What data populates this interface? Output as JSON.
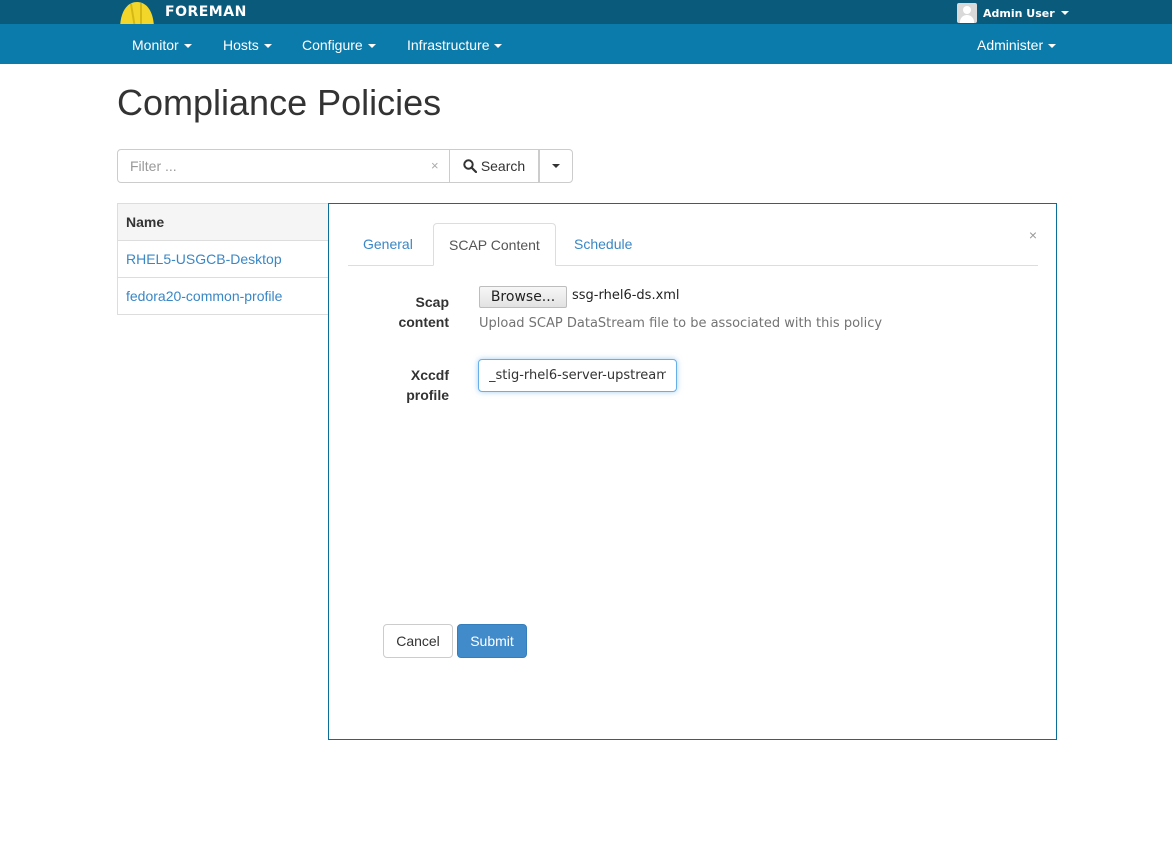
{
  "header": {
    "brand": "FOREMAN",
    "user": "Admin User"
  },
  "nav": {
    "items": [
      "Monitor",
      "Hosts",
      "Configure",
      "Infrastructure"
    ],
    "right": "Administer"
  },
  "page": {
    "title": "Compliance Policies"
  },
  "search": {
    "placeholder": "Filter ...",
    "clear": "×",
    "button_label": "Search"
  },
  "table": {
    "header": "Name",
    "rows": [
      "RHEL5-USGCB-Desktop",
      "fedora20-common-profile"
    ]
  },
  "modal": {
    "close": "×",
    "tabs": [
      "General",
      "SCAP Content",
      "Schedule"
    ],
    "active_tab": "SCAP Content",
    "scap_label_line1": "Scap",
    "scap_label_line2": "content",
    "browse_label": "Browse...",
    "file_name": "ssg-rhel6-ds.xml",
    "help": "Upload SCAP DataStream file to be associated with this policy",
    "xccdf_label_line1": "Xccdf",
    "xccdf_label_line2": "profile",
    "xccdf_value": "_stig-rhel6-server-upstream",
    "cancel": "Cancel",
    "submit": "Submit"
  },
  "colors": {
    "header_bg": "#0a5a7c",
    "nav_bg": "#0b7bab",
    "link": "#3a87c5",
    "primary_button": "#428bca"
  }
}
